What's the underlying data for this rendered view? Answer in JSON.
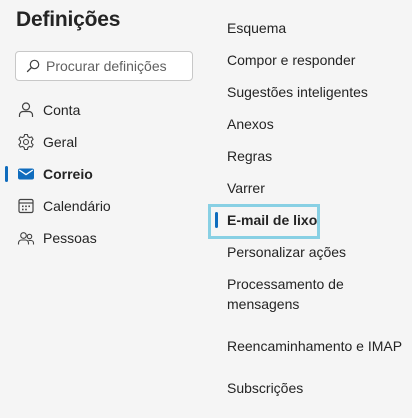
{
  "settings": {
    "title": "Definições",
    "search": {
      "placeholder": "Procurar definições",
      "value": ""
    },
    "nav": [
      {
        "label": "Conta",
        "icon": "person-icon",
        "selected": false
      },
      {
        "label": "Geral",
        "icon": "gear-icon",
        "selected": false
      },
      {
        "label": "Correio",
        "icon": "mail-icon",
        "selected": true
      },
      {
        "label": "Calendário",
        "icon": "calendar-icon",
        "selected": false
      },
      {
        "label": "Pessoas",
        "icon": "people-icon",
        "selected": false
      }
    ],
    "mail_sections": [
      {
        "label": "Esquema"
      },
      {
        "label": "Compor e responder"
      },
      {
        "label": "Sugestões inteligentes"
      },
      {
        "label": "Anexos"
      },
      {
        "label": "Regras"
      },
      {
        "label": "Varrer"
      },
      {
        "label": "E-mail de lixo",
        "selected": true
      },
      {
        "label": "Personalizar ações"
      },
      {
        "label": "Processamento de mensagens"
      },
      {
        "label": "Reencaminhamento e IMAP"
      },
      {
        "label": "Subscrições"
      }
    ]
  },
  "colors": {
    "accent": "#0f6cbd",
    "focus_outline": "#88d0e4",
    "background": "#f5f5f5"
  }
}
